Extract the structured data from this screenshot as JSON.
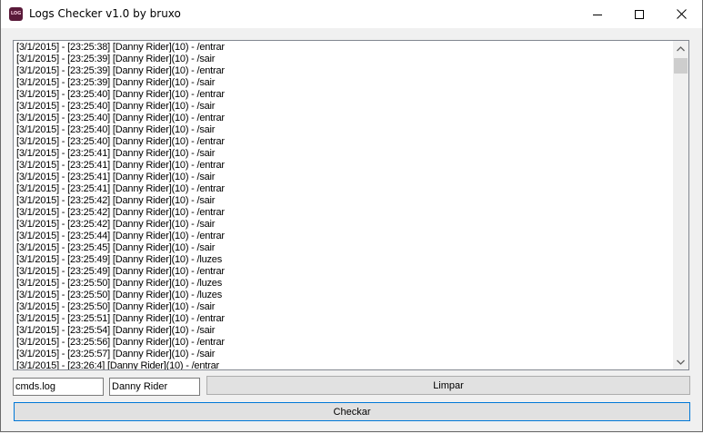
{
  "window": {
    "title": "Logs Checker v1.0 by bruxo",
    "icon_text": "LOG",
    "icon": "app-log-icon"
  },
  "title_buttons": {
    "minimize_icon": "minimize-icon",
    "maximize_icon": "maximize-icon",
    "close_icon": "close-icon"
  },
  "log": {
    "lines": [
      "[3/1/2015] - [23:25:38] [Danny Rider](10) - /entrar",
      "[3/1/2015] - [23:25:39] [Danny Rider](10) - /sair",
      "[3/1/2015] - [23:25:39] [Danny Rider](10) - /entrar",
      "[3/1/2015] - [23:25:39] [Danny Rider](10) - /sair",
      "[3/1/2015] - [23:25:40] [Danny Rider](10) - /entrar",
      "[3/1/2015] - [23:25:40] [Danny Rider](10) - /sair",
      "[3/1/2015] - [23:25:40] [Danny Rider](10) - /entrar",
      "[3/1/2015] - [23:25:40] [Danny Rider](10) - /sair",
      "[3/1/2015] - [23:25:40] [Danny Rider](10) - /entrar",
      "[3/1/2015] - [23:25:41] [Danny Rider](10) - /sair",
      "[3/1/2015] - [23:25:41] [Danny Rider](10) - /entrar",
      "[3/1/2015] - [23:25:41] [Danny Rider](10) - /sair",
      "[3/1/2015] - [23:25:41] [Danny Rider](10) - /entrar",
      "[3/1/2015] - [23:25:42] [Danny Rider](10) - /sair",
      "[3/1/2015] - [23:25:42] [Danny Rider](10) - /entrar",
      "[3/1/2015] - [23:25:42] [Danny Rider](10) - /sair",
      "[3/1/2015] - [23:25:44] [Danny Rider](10) - /entrar",
      "[3/1/2015] - [23:25:45] [Danny Rider](10) - /sair",
      "[3/1/2015] - [23:25:49] [Danny Rider](10) - /luzes",
      "[3/1/2015] - [23:25:49] [Danny Rider](10) - /entrar",
      "[3/1/2015] - [23:25:50] [Danny Rider](10) - /luzes",
      "[3/1/2015] - [23:25:50] [Danny Rider](10) - /luzes",
      "[3/1/2015] - [23:25:50] [Danny Rider](10) - /sair",
      "[3/1/2015] - [23:25:51] [Danny Rider](10) - /entrar",
      "[3/1/2015] - [23:25:54] [Danny Rider](10) - /sair",
      "[3/1/2015] - [23:25:56] [Danny Rider](10) - /entrar",
      "[3/1/2015] - [23:25:57] [Danny Rider](10) - /sair",
      "[3/1/2015] - [23:26:4] [Danny Rider](10) - /entrar"
    ],
    "scroll_up_icon": "scroll-up-arrow-icon",
    "scroll_down_icon": "scroll-down-arrow-icon"
  },
  "controls": {
    "file_value": "cmds.log",
    "name_value": "Danny Rider",
    "clear_label": "Limpar",
    "check_label": "Checkar"
  }
}
